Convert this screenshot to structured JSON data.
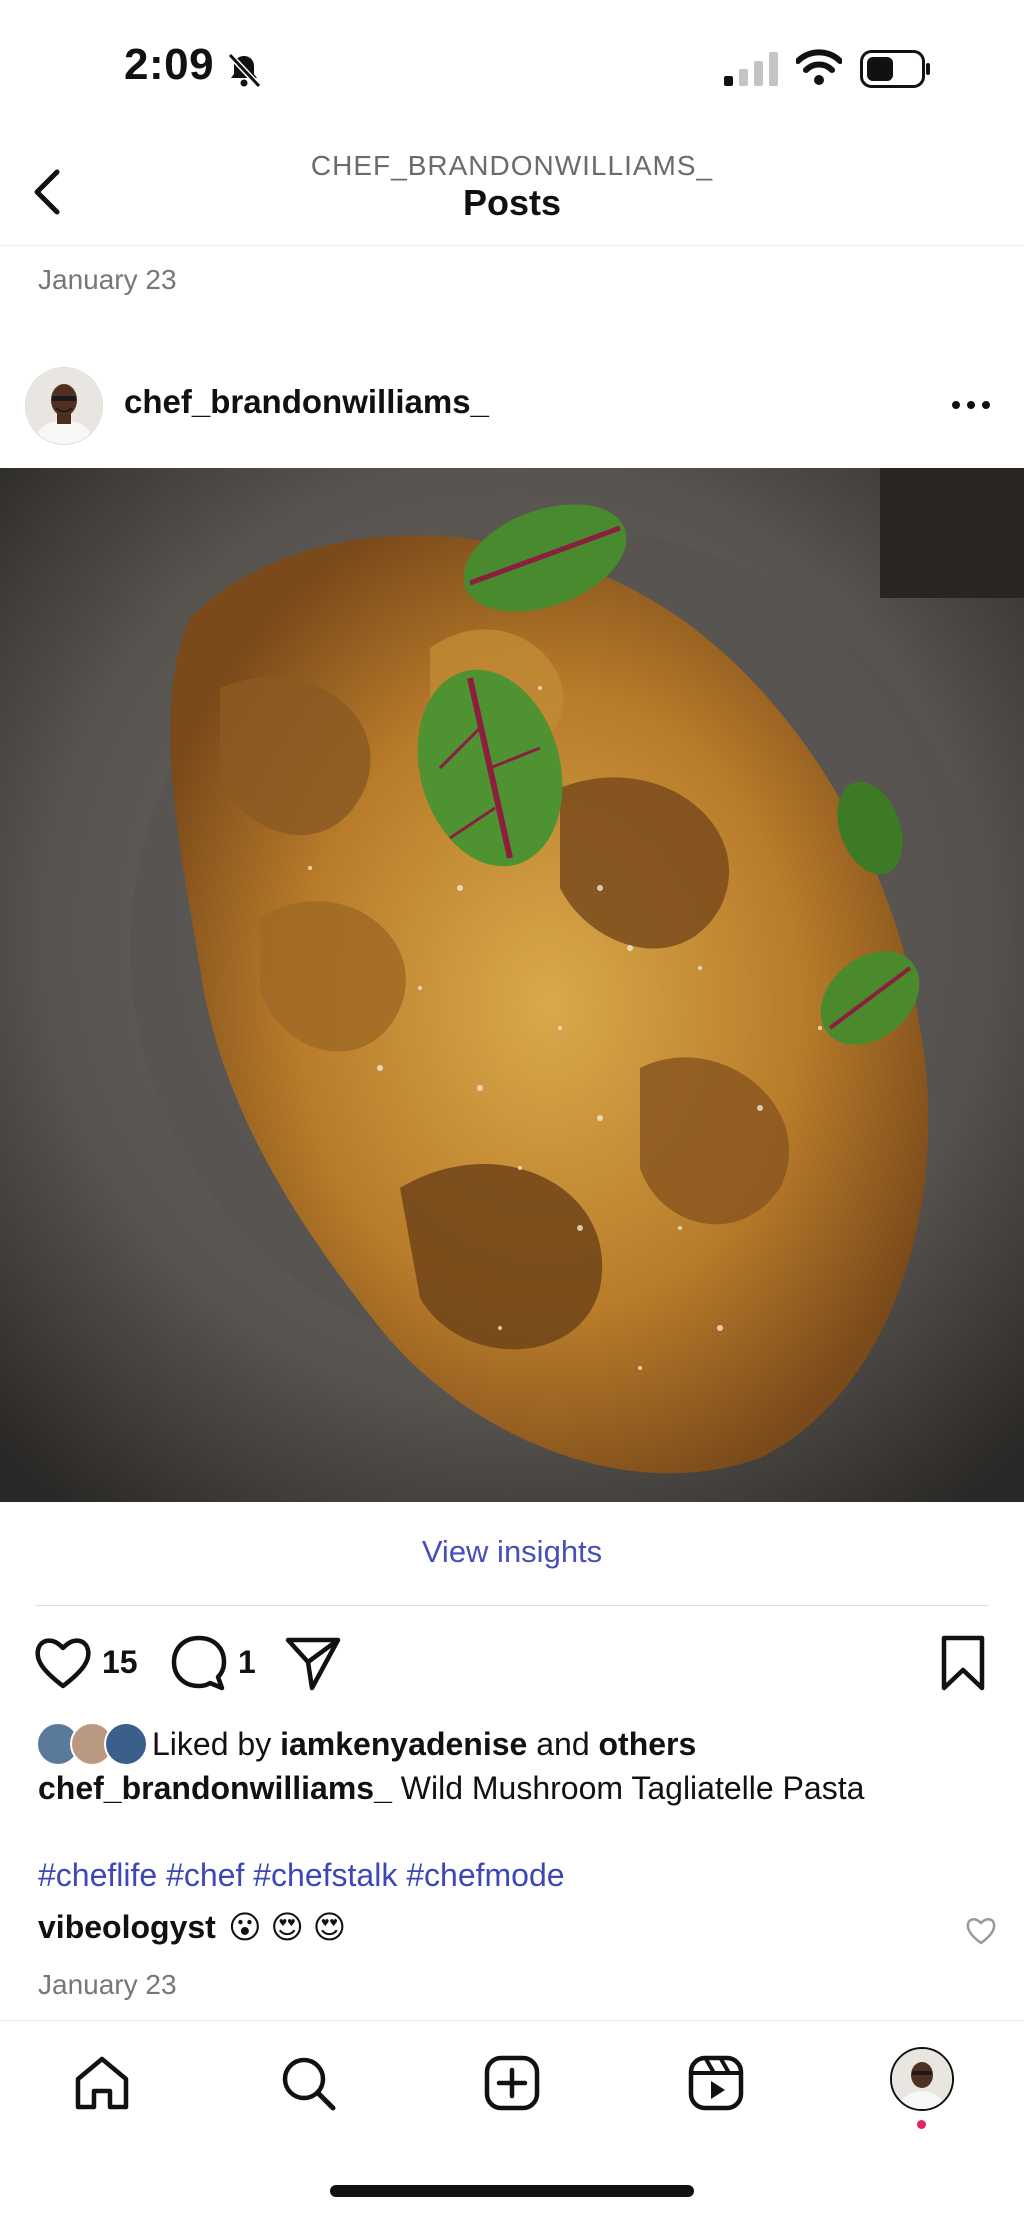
{
  "status_bar": {
    "time": "2:09"
  },
  "header": {
    "account": "CHEF_BRANDONWILLIAMS_",
    "title": "Posts"
  },
  "post": {
    "date_top": "January 23",
    "username": "chef_brandonwilliams_",
    "view_insights": "View insights",
    "likes_count": "15",
    "comments_count": "1",
    "liked_by_prefix": "Liked by",
    "liked_by_user": "iamkenyadenise",
    "liked_by_and": "and",
    "liked_by_others": "others",
    "caption_user": "chef_brandonwilliams_",
    "caption_text": "Wild Mushroom Tagliatelle Pasta",
    "hashtags": "#cheflife #chef #chefstalk #chefmode",
    "comment_user": "vibeologyst",
    "comment_text": "😮 😍 😍",
    "date_bottom": "January 23"
  },
  "colors": {
    "link": "#3c48b5",
    "insights": "#4750b8",
    "notif": "#e0245e"
  },
  "icons": {
    "back": "chevron-left-icon",
    "more": "more-horizontal-icon",
    "like": "heart-icon",
    "comment": "comment-icon",
    "share": "send-icon",
    "save": "bookmark-icon",
    "tabs": [
      "home-icon",
      "search-icon",
      "create-icon",
      "reels-icon",
      "profile-icon"
    ]
  }
}
